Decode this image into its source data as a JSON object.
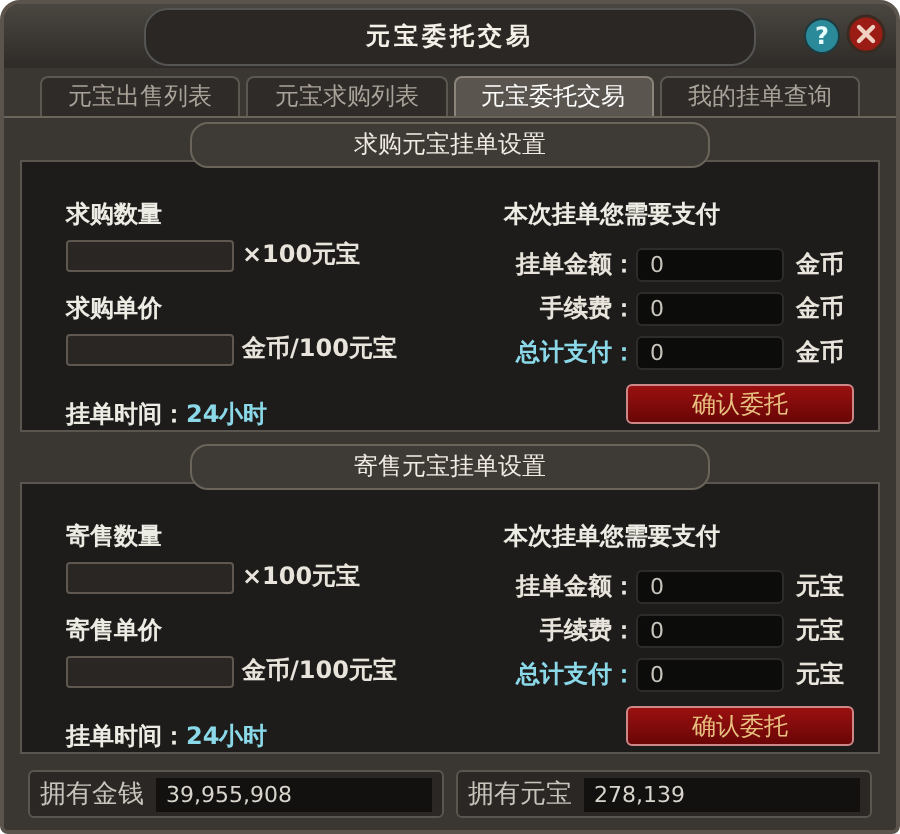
{
  "window": {
    "title": "元宝委托交易",
    "help": "?"
  },
  "tabs": [
    {
      "label": "元宝出售列表",
      "selected": false
    },
    {
      "label": "元宝求购列表",
      "selected": false
    },
    {
      "label": "元宝委托交易",
      "selected": true
    },
    {
      "label": "我的挂单查询",
      "selected": false
    }
  ],
  "sections": [
    {
      "title": "求购元宝挂单设置",
      "fields": [
        {
          "label": "求购数量",
          "unit": "×100元宝"
        },
        {
          "label": "求购单价",
          "unit": "金币/100元宝"
        }
      ],
      "time_label": "挂单时间：",
      "time_value": "24小时",
      "payment_heading": "本次挂单您需要支付",
      "payments": [
        {
          "label": "挂单金额：",
          "value": "0",
          "unit": "金币",
          "highlight": false
        },
        {
          "label": "手续费：",
          "value": "0",
          "unit": "金币",
          "highlight": false
        },
        {
          "label": "总计支付：",
          "value": "0",
          "unit": "金币",
          "highlight": true
        }
      ],
      "button": "确认委托"
    },
    {
      "title": "寄售元宝挂单设置",
      "fields": [
        {
          "label": "寄售数量",
          "unit": "×100元宝"
        },
        {
          "label": "寄售单价",
          "unit": "金币/100元宝"
        }
      ],
      "time_label": "挂单时间：",
      "time_value": "24小时",
      "payment_heading": "本次挂单您需要支付",
      "payments": [
        {
          "label": "挂单金额：",
          "value": "0",
          "unit": "元宝",
          "highlight": false
        },
        {
          "label": "手续费：",
          "value": "0",
          "unit": "元宝",
          "highlight": false
        },
        {
          "label": "总计支付：",
          "value": "0",
          "unit": "元宝",
          "highlight": true
        }
      ],
      "button": "确认委托"
    }
  ],
  "footer": [
    {
      "label": "拥有金钱",
      "value": "39,955,908"
    },
    {
      "label": "拥有元宝",
      "value": "278,139"
    }
  ]
}
